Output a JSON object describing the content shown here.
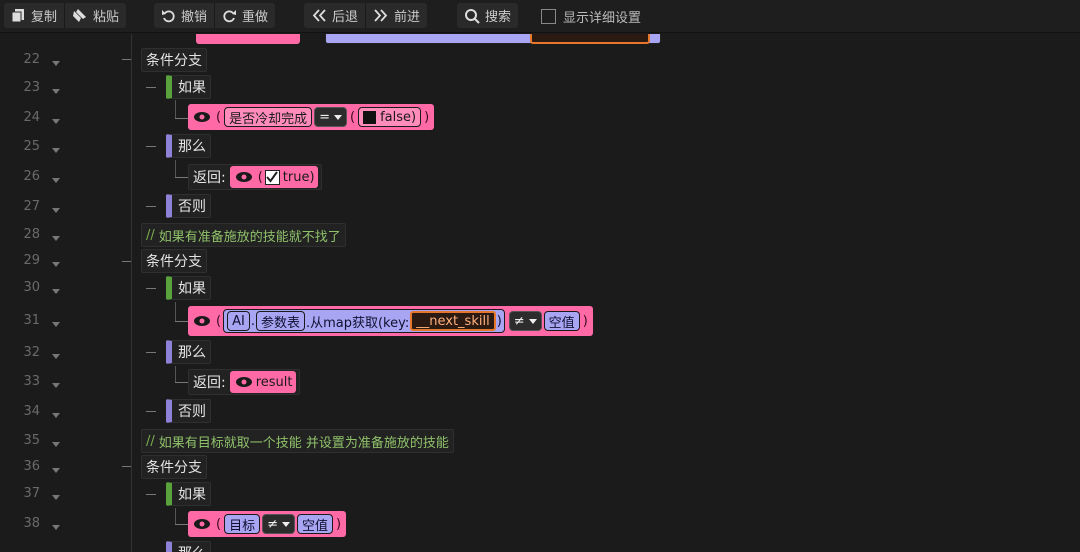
{
  "toolbar": {
    "copy": "复制",
    "paste": "粘贴",
    "undo": "撤销",
    "redo": "重做",
    "back": "后退",
    "forward": "前进",
    "search": "搜索",
    "show_details": "显示详细设置"
  },
  "line_numbers": [
    "22",
    "23",
    "24",
    "25",
    "26",
    "27",
    "28",
    "29",
    "30",
    "31",
    "32",
    "33",
    "34",
    "35",
    "36",
    "37",
    "38"
  ],
  "code": {
    "branch": "条件分支",
    "if": "如果",
    "then": "那么",
    "else": "否则",
    "return": "返回:",
    "l24_var": "是否冷却完成",
    "l24_op": "=",
    "l24_val": "false)",
    "l26_val": "true)",
    "l28_comment": "如果有准备施放的技能就不找了",
    "l31_ai": "AI",
    "l31_dot": ".",
    "l31_params": "参数表",
    "l31_call": ".从map获取(key:",
    "l31_key": "__next_skill",
    "l31_close": ")",
    "l31_op": "≠",
    "l31_null": "空值",
    "l33_result": "result",
    "l35_comment": "如果有目标就取一个技能 并设置为准备施放的技能",
    "l38_target": "目标",
    "l38_op": "≠",
    "l38_null": "空值",
    "slash": "//",
    "lparen": "(",
    "rparen": ")",
    "partial": "那么"
  },
  "colors": {
    "pink_expr": "#ff6aa6",
    "blue_chip": "#a8a6f3",
    "green_bar": "#5aa23b",
    "purple_bar": "#8d82d8",
    "comment": "#8fc16a"
  }
}
